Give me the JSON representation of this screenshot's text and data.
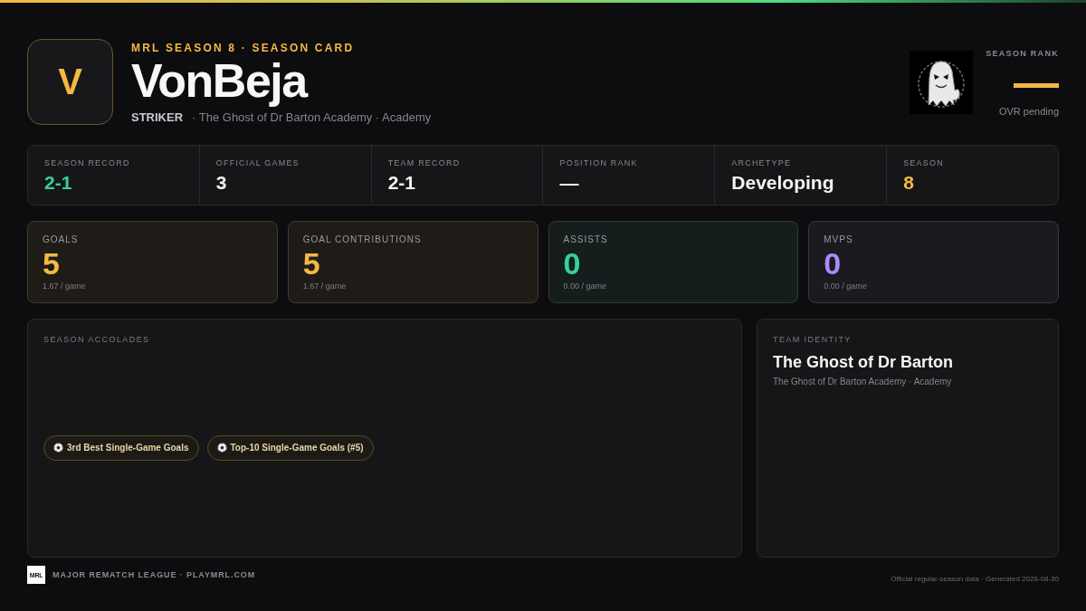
{
  "header": {
    "avatar_letter": "V",
    "eyebrow": "MRL SEASON 8 · SEASON CARD",
    "player_name": "VonBeja",
    "position": "STRIKER",
    "team_line": "· The Ghost of Dr Barton Academy · Academy",
    "rank": {
      "label": "SEASON RANK",
      "value": "—",
      "note": "OVR pending"
    }
  },
  "summary": [
    {
      "label": "SEASON RECORD",
      "value": "2-1",
      "color": "#34d399"
    },
    {
      "label": "OFFICIAL GAMES",
      "value": "3",
      "color": "#f4f4f5"
    },
    {
      "label": "TEAM RECORD",
      "value": "2-1",
      "color": "#f4f4f5"
    },
    {
      "label": "POSITION RANK",
      "value": "—",
      "color": "#f4f4f5"
    },
    {
      "label": "ARCHETYPE",
      "value": "Developing",
      "color": "#f4f4f5"
    },
    {
      "label": "SEASON",
      "value": "8",
      "color": "#f5b942"
    }
  ],
  "stat_cards": [
    {
      "label": "GOALS",
      "value": "5",
      "per_game": "1.67 / game",
      "color": "#f5b942"
    },
    {
      "label": "GOAL CONTRIBUTIONS",
      "value": "5",
      "per_game": "1.67 / game",
      "color": "#f5b942"
    },
    {
      "label": "ASSISTS",
      "value": "0",
      "per_game": "0.00 / game",
      "color": "#34d399"
    },
    {
      "label": "MVPS",
      "value": "0",
      "per_game": "0.00 / game",
      "color": "#a78bfa"
    }
  ],
  "accolades": {
    "title": "SEASON ACCOLADES",
    "items": [
      "3rd Best Single-Game Goals",
      "Top-10 Single-Game Goals (#5)"
    ]
  },
  "team_identity": {
    "title": "TEAM IDENTITY",
    "name": "The Ghost of Dr Barton",
    "detail": "The Ghost of Dr Barton Academy · Academy"
  },
  "footer": {
    "logo": "MRL",
    "brand": "MAJOR REMATCH LEAGUE · PLAYMRL.COM",
    "note": "Official regular-season data · Generated 2026-08-30"
  }
}
